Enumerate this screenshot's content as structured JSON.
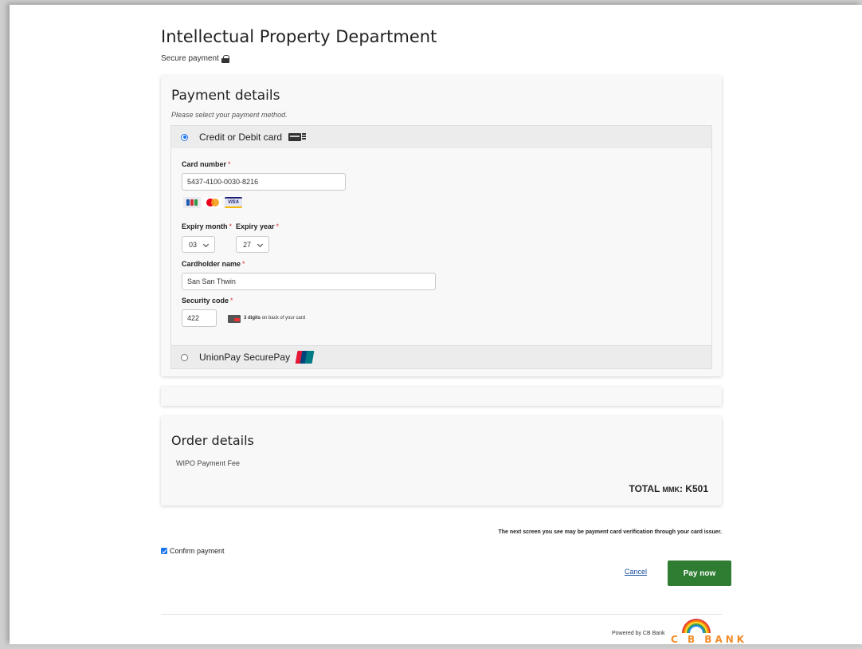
{
  "header": {
    "title": "Intellectual Property Department",
    "secure_label": "Secure payment"
  },
  "payment": {
    "title": "Payment details",
    "hint": "Please select your payment method.",
    "methods": [
      {
        "label": "Credit or Debit card",
        "selected": true,
        "icon": "credit-card-icon"
      },
      {
        "label": "UnionPay SecurePay",
        "selected": false,
        "icon": "unionpay-icon"
      }
    ],
    "card_number_label": "Card number",
    "card_number_value": "5437-4100-0030-8216",
    "card_brands": [
      "jcb-icon",
      "mastercard-icon",
      "visa-icon"
    ],
    "visa_text": "VISA",
    "expiry_month_label": "Expiry month",
    "expiry_month_value": "03",
    "expiry_year_label": "Expiry year",
    "expiry_year_value": "27",
    "cardholder_label": "Cardholder name",
    "cardholder_value": "San San Thwin",
    "security_label": "Security code",
    "security_value": "422",
    "security_hint_bold": "3 digits",
    "security_hint_rest": "on back of your card",
    "required_mark": "*"
  },
  "order": {
    "title": "Order details",
    "item": "WIPO Payment Fee",
    "total_label": "TOTAL",
    "currency": "MMK",
    "total_value": ": K501"
  },
  "footer": {
    "note": "The next screen you see may be payment card verification through your card issuer.",
    "confirm_label": "Confirm payment",
    "confirm_checked": true,
    "cancel_label": "Cancel",
    "pay_label": "Pay now",
    "powered_by": "Powered by CB Bank",
    "bank_logo_text": "C B BANK"
  },
  "colors": {
    "pay_button": "#2e7d32",
    "link": "#1a4fa0",
    "required": "#dd3333",
    "radio_selected": "#1a73e8"
  }
}
